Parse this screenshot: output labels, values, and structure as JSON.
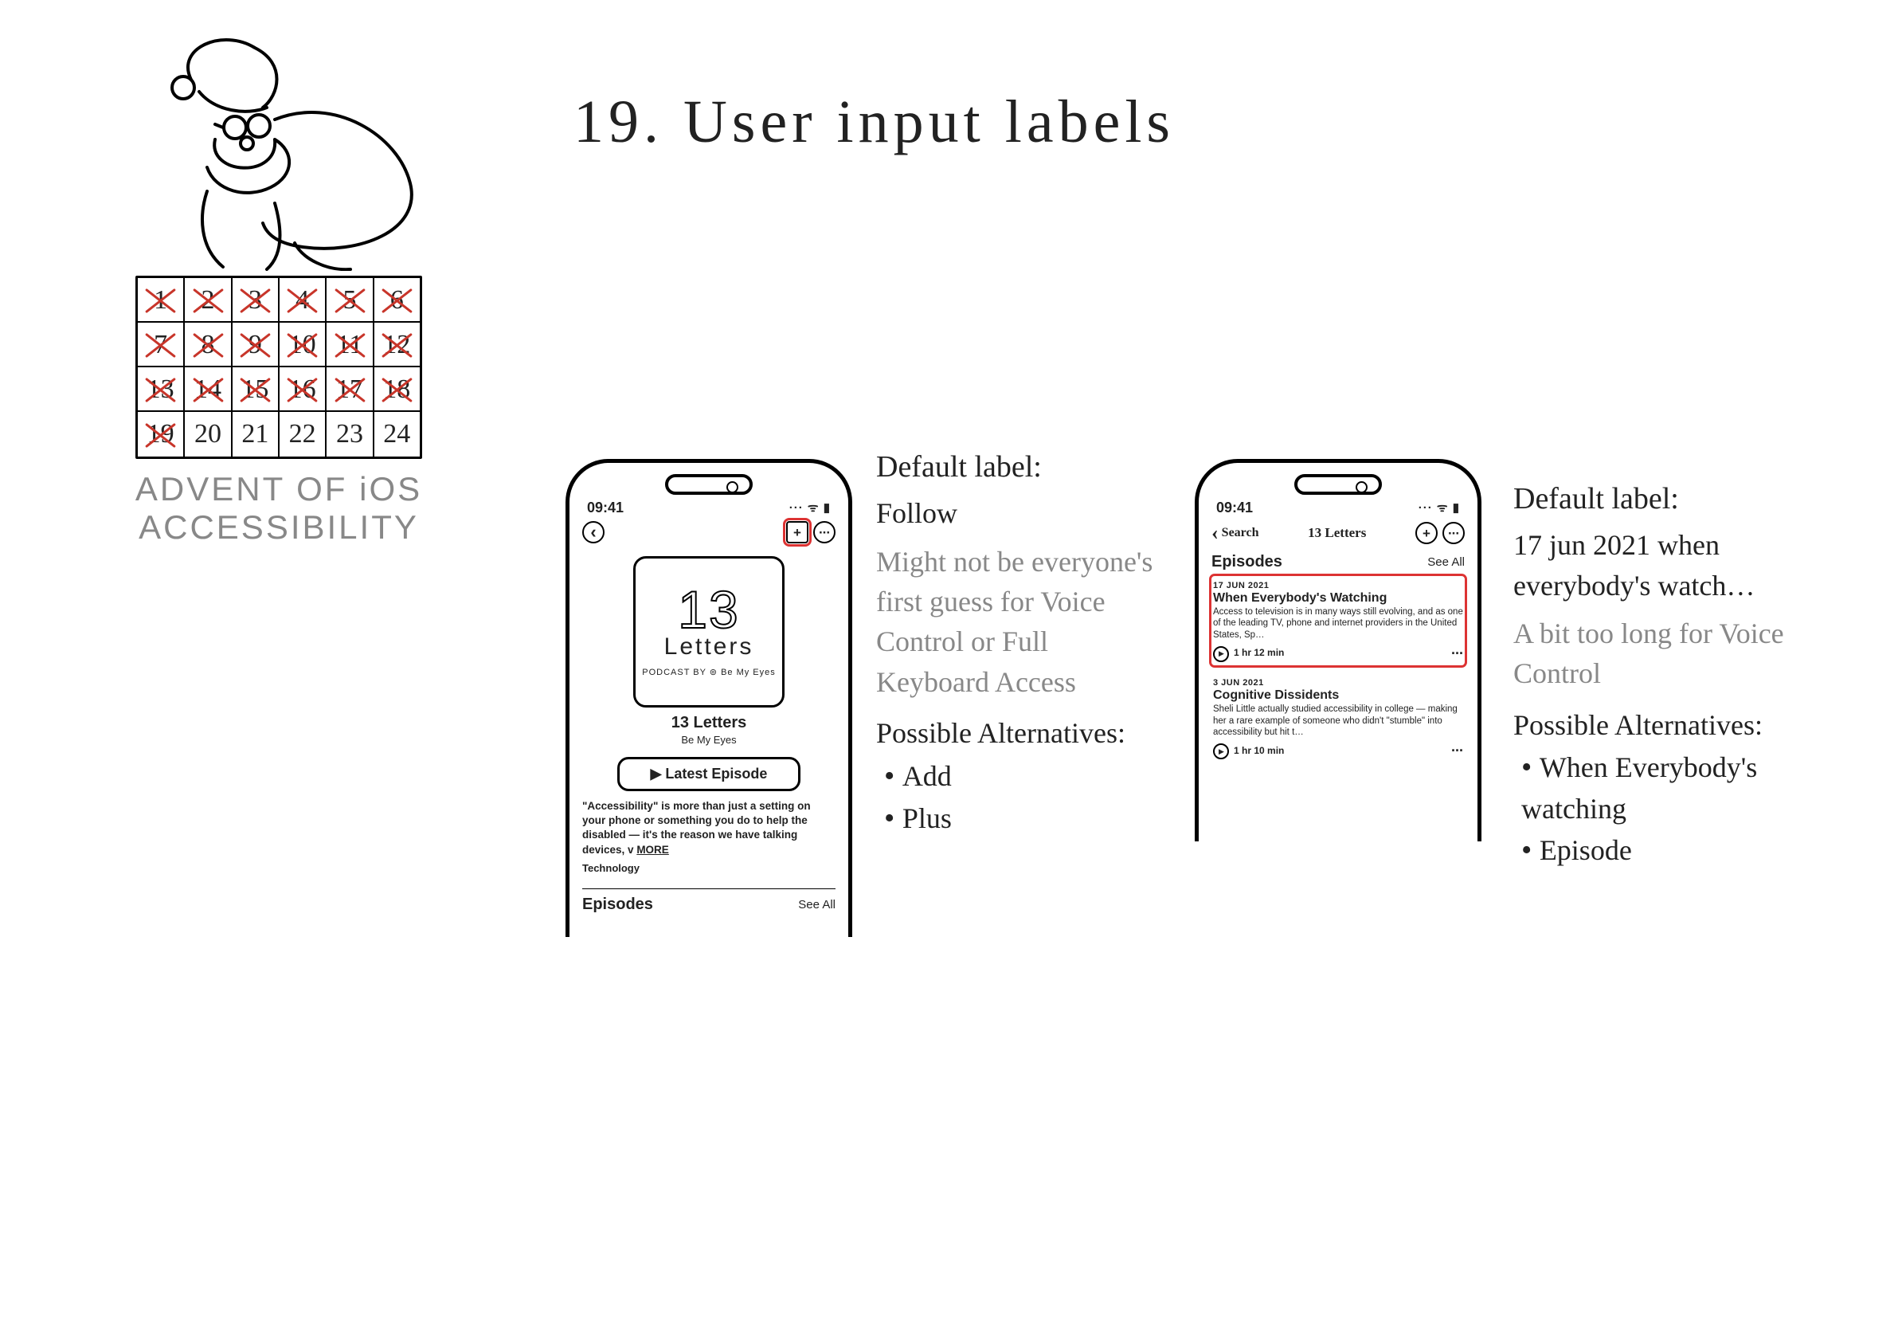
{
  "title": "19. User input labels",
  "advent": {
    "caption_line1": "ADVENT OF iOS",
    "caption_line2": "ACCESSIBILITY",
    "days": [
      {
        "n": "1",
        "x": true
      },
      {
        "n": "2",
        "x": true
      },
      {
        "n": "3",
        "x": true
      },
      {
        "n": "4",
        "x": true
      },
      {
        "n": "5",
        "x": true
      },
      {
        "n": "6",
        "x": true
      },
      {
        "n": "7",
        "x": true
      },
      {
        "n": "8",
        "x": true
      },
      {
        "n": "9",
        "x": true
      },
      {
        "n": "10",
        "x": true
      },
      {
        "n": "11",
        "x": true
      },
      {
        "n": "12",
        "x": true
      },
      {
        "n": "13",
        "x": true
      },
      {
        "n": "14",
        "x": true
      },
      {
        "n": "15",
        "x": true
      },
      {
        "n": "16",
        "x": true
      },
      {
        "n": "17",
        "x": true
      },
      {
        "n": "18",
        "x": true
      },
      {
        "n": "19",
        "x": true
      },
      {
        "n": "20",
        "x": false
      },
      {
        "n": "21",
        "x": false
      },
      {
        "n": "22",
        "x": false
      },
      {
        "n": "23",
        "x": false
      },
      {
        "n": "24",
        "x": false
      }
    ]
  },
  "phone_common": {
    "time": "09:41",
    "indicators": "···  ᯤ  ▮"
  },
  "phone1": {
    "cover_big": "13",
    "cover_med": "Letters",
    "cover_small": "PODCAST BY  ⊚ Be My Eyes",
    "podcast_title": "13 Letters",
    "podcast_sub": "Be My Eyes",
    "latest_btn": "▶ Latest Episode",
    "desc": "\"Accessibility\" is more than just a setting on your phone or something you do to help the disabled — it's the reason we have talking devices, v ",
    "more": "MORE",
    "category": "Technology",
    "section": "Episodes",
    "see_all": "See All"
  },
  "phone2": {
    "back": "Search",
    "navtitle": "13 Letters",
    "section": "Episodes",
    "see_all": "See All",
    "ep1": {
      "date": "17 JUN 2021",
      "title": "When Everybody's Watching",
      "blurb": "Access to television is in many ways still evolving, and as one of the leading TV, phone and internet providers in the United States, Sp…",
      "dur": "1 hr 12 min"
    },
    "ep2": {
      "date": "3 JUN 2021",
      "title": "Cognitive Dissidents",
      "blurb": "Sheli Little actually studied accessibility in college — making her a rare example of someone who didn't \"stumble\" into accessibility but hit t…",
      "dur": "1 hr 10 min"
    }
  },
  "notes1": {
    "h": "Default label:",
    "val": "Follow",
    "gray": "Might not be everyone's first guess for Voice Control or Full Keyboard Access",
    "alts_h": "Possible Alternatives:",
    "alt1": "Add",
    "alt2": "Plus"
  },
  "notes2": {
    "h": "Default label:",
    "val": "17 jun 2021 when everybody's watch…",
    "gray": "A bit too long for Voice Control",
    "alts_h": "Possible Alternatives:",
    "alt1": "When Everybody's watching",
    "alt2": "Episode"
  }
}
